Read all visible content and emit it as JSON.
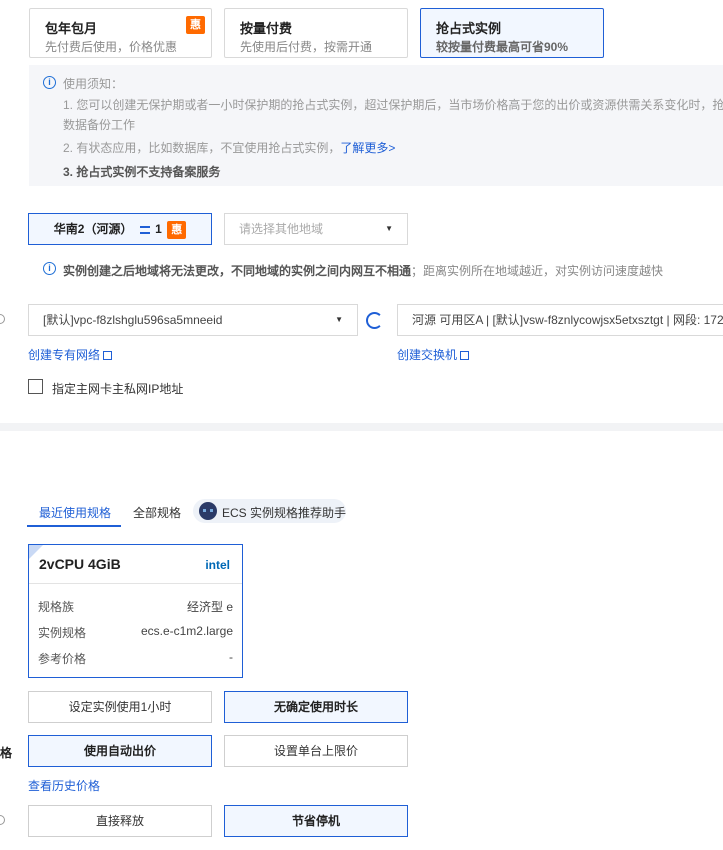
{
  "billing": [
    {
      "title": "包年包月",
      "sub": "先付费后使用，价格优惠",
      "badge": "惠"
    },
    {
      "title": "按量付费",
      "sub": "先使用后付费，按需开通"
    },
    {
      "title": "抢占式实例",
      "sub": "较按量付费最高可省90%"
    }
  ],
  "notice": {
    "heading": "使用须知：",
    "line1": "1. 您可以创建无保护期或者一小时保护期的抢占式实例，超过保护期后，当市场价格高于您的出价或资源供需关系变化时，抢",
    "line1b": "数据备份工作",
    "line2": "2. 有状态应用，比如数据库，不宜使用抢占式实例，",
    "line2_link": "了解更多>",
    "line3": "3. 抢占式实例不支持备案服务"
  },
  "region": {
    "selected": "华南2（河源）",
    "count": "1",
    "badge": "惠",
    "other_placeholder": "请选择其他地域",
    "warning_bold": "实例创建之后地域将无法更改，不同地域的实例之间内网互不相通",
    "warning_rest": "；距离实例所在地域越近，对实例访问速度越快"
  },
  "network": {
    "vpc": "[默认]vpc-f8zlshglu596sa5mneeid",
    "vswitch": "河源 可用区A | [默认]vsw-f8znlycowjsx5etxsztgt | 网段: 172",
    "create_vpc": "创建专有网络",
    "create_vswitch": "创建交换机",
    "checkbox_label": "指定主网卡主私网IP地址"
  },
  "spec_tabs": {
    "recent": "最近使用规格",
    "all": "全部规格",
    "assistant": "ECS 实例规格推荐助手"
  },
  "spec_card": {
    "title": "2vCPU 4GiB",
    "brand": "intel",
    "rows": [
      {
        "label": "规格族",
        "value": "经济型 e"
      },
      {
        "label": "实例规格",
        "value": "ecs.e-c1m2.large"
      },
      {
        "label": "参考价格",
        "value": "-"
      }
    ]
  },
  "duration": {
    "opt1": "设定实例使用1小时",
    "opt2": "无确定使用时长"
  },
  "price": {
    "label_fragment": "格",
    "opt1": "使用自动出价",
    "opt2": "设置单台上限价",
    "history": "查看历史价格"
  },
  "release": {
    "opt1": "直接释放",
    "opt2": "节省停机"
  },
  "colors": {
    "accent": "#1f5fd6",
    "badge": "#ff6a00"
  }
}
